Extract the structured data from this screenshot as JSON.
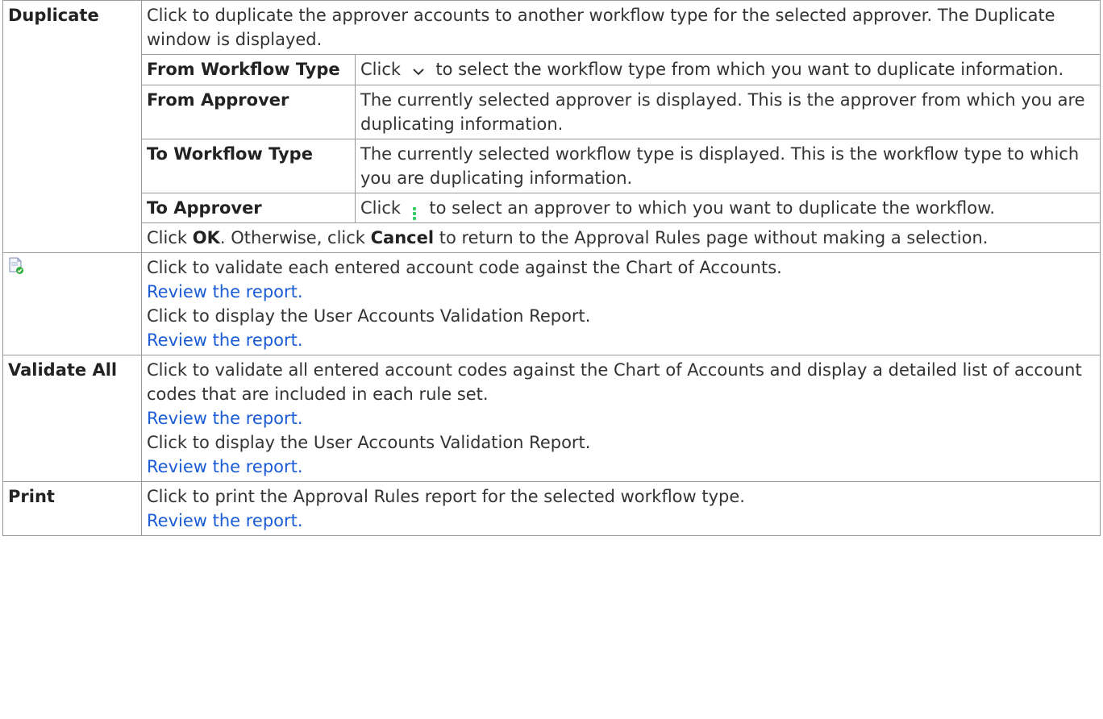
{
  "rows": {
    "duplicate": {
      "label": "Duplicate",
      "desc": "Click to duplicate the approver accounts to another workflow type for the selected approver. The Duplicate window is displayed.",
      "fields": [
        {
          "label": "From Workflow Type",
          "pre": "Click",
          "icon": "chevron-down-icon",
          "post": "to select the workflow type from which you want to duplicate information."
        },
        {
          "label": "From Approver",
          "text": "The currently selected approver is displayed. This is the approver from which you are duplicating information."
        },
        {
          "label": "To Workflow Type",
          "text": "The currently selected workflow type is displayed. This is the workflow type to which you are duplicating information."
        },
        {
          "label": "To Approver",
          "pre": "Click",
          "icon": "vertical-dots-icon",
          "post": "to select an approver to which you want to duplicate the workflow."
        }
      ],
      "footer": {
        "t1": "Click ",
        "ok": "OK",
        "t2": ". Otherwise, click ",
        "cancel": "Cancel",
        "t3": " to return to the Approval Rules page without making a selection."
      }
    },
    "validate": {
      "icon": "validate-document-icon",
      "line1": "Click to validate each entered account code against the Chart of Accounts.",
      "link1": "Review the report.",
      "line2": "Click to display the User Accounts Validation Report.",
      "link2": "Review the report."
    },
    "validate_all": {
      "label": "Validate All",
      "line1": "Click to validate all entered account codes against the Chart of Accounts and display a detailed list of account codes that are included in each rule set.",
      "link1": "Review the report.",
      "line2": "Click to display the User Accounts Validation Report.",
      "link2": "Review the report."
    },
    "print": {
      "label": "Print",
      "line1": "Click to print the Approval Rules report for the selected workflow type.",
      "link1": "Review the report."
    }
  },
  "colors": {
    "link": "#1a5bd6",
    "border": "#999999"
  }
}
